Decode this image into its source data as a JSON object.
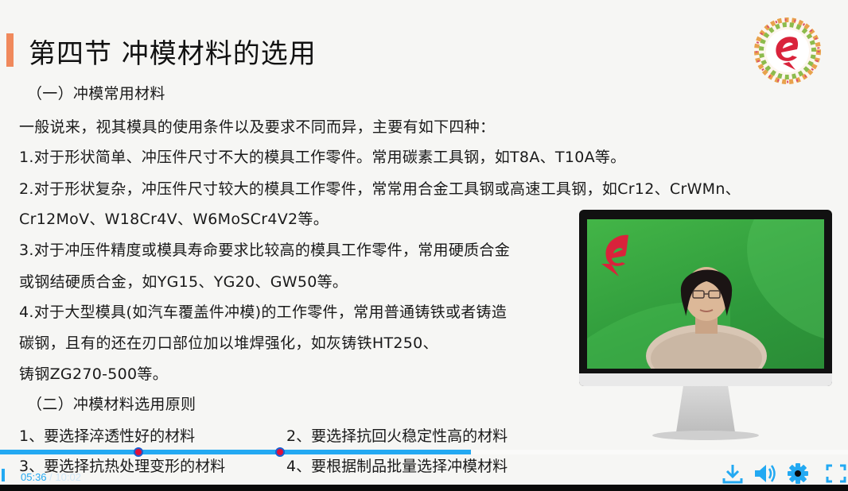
{
  "slide": {
    "title": "第四节  冲模材料的选用",
    "section1": "（一）冲模常用材料",
    "lines": [
      "一般说来，视其模具的使用条件以及要求不同而异，主要有如下四种：",
      "1.对于形状简单、冲压件尺寸不大的模具工作零件。常用碳素工具钢，如T8A、T10A等。",
      "2.对于形状复杂，冲压件尺寸较大的模具工作零件，常常用合金工具钢或高速工具钢，如Cr12、CrWMn、",
      "Cr12MoV、W18Cr4V、W6MoSCr4V2等。",
      "3.对于冲压件精度或模具寿命要求比较高的模具工作零件，常用硬质合金",
      "或钢结硬质合金，如YG15、YG20、GW50等。",
      "4.对于大型模具(如汽车覆盖件冲模)的工作零件，常用普通铸铁或者铸造",
      "碳钢，且有的还在刃口部位加以堆焊强化，如灰铸铁HT250、",
      "铸钢ZG270-500等。"
    ],
    "section2": "（二）冲模材料选用原则",
    "principles": [
      "1、要选择淬透性好的材料",
      "2、要选择抗回火稳定性高的材料",
      "3、要选择抗热处理变形的材料",
      "4、要根据制品批量选择冲模材料"
    ]
  },
  "player": {
    "current_time": "05:36",
    "separator": " / ",
    "total_time": "10:02",
    "progress_fraction": 0.555,
    "markers_fraction": [
      0.163,
      0.33
    ],
    "icons": [
      "download-icon",
      "volume-icon",
      "settings-gear-icon",
      "fullscreen-icon"
    ],
    "accent_color": "#23a9f2"
  },
  "colors": {
    "title_accent": "#f0895c",
    "screen_green": "#43b547",
    "logo_red": "#d9233b"
  }
}
